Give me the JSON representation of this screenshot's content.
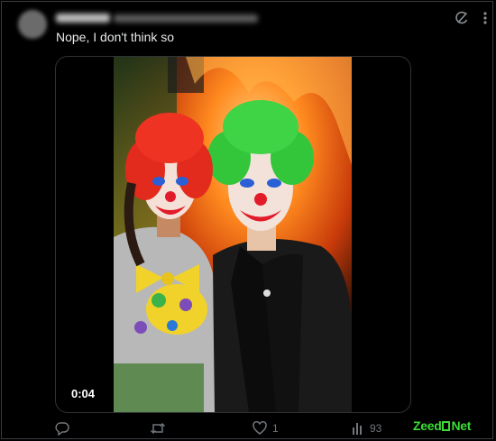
{
  "post": {
    "author_name": "",
    "author_handle": "",
    "text": "Nope, I don't think so"
  },
  "media": {
    "duration": "0:04",
    "description_icon": "video-thumbnail"
  },
  "actions": {
    "reply": {
      "icon": "reply-icon",
      "count": ""
    },
    "retweet": {
      "icon": "retweet-icon",
      "count": ""
    },
    "like": {
      "icon": "heart-icon",
      "count": "1"
    },
    "views": {
      "icon": "bar-chart-icon",
      "count": "93"
    },
    "bookmark": {
      "icon": "bookmark-icon"
    }
  },
  "watermark": {
    "left": "Zeed",
    "right": "Net"
  },
  "colors": {
    "background": "#000000",
    "text": "#e7e9ea",
    "muted": "#71767b",
    "border": "#2f3336",
    "watermark": "#3ddc36"
  }
}
